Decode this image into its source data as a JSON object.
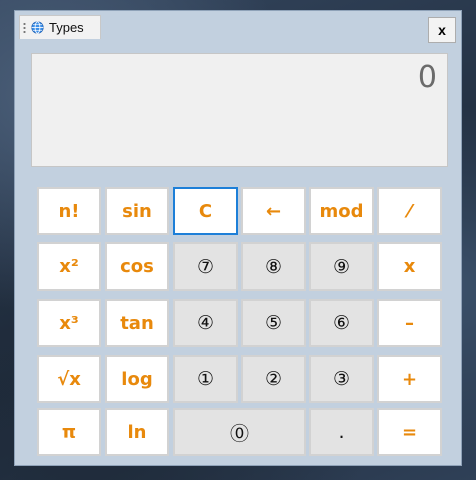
{
  "window": {
    "title": "Types",
    "close_label": "x"
  },
  "display": {
    "value": "0"
  },
  "keys": {
    "factorial": "n!",
    "sin": "sin",
    "clear": "C",
    "backspace": "←",
    "mod": "mod",
    "divide": "⁄",
    "square": "x²",
    "cos": "cos",
    "seven": "⑦",
    "eight": "⑧",
    "nine": "⑨",
    "multiply": "x",
    "cube": "x³",
    "tan": "tan",
    "four": "④",
    "five": "⑤",
    "six": "⑥",
    "subtract": "–",
    "sqrt": "√x",
    "log": "log",
    "one": "①",
    "two": "②",
    "three": "③",
    "add": "+",
    "pi": "π",
    "ln": "ln",
    "zero": "⓪",
    "decimal": ".",
    "equals": "="
  },
  "colors": {
    "accent": "#e8890c",
    "focus_border": "#1d7fd8",
    "window_bg": "#c2d0df",
    "display_bg": "#f0f0f0"
  },
  "icons": {
    "tab": "globe-icon",
    "grip": "drag-grip-icon"
  }
}
